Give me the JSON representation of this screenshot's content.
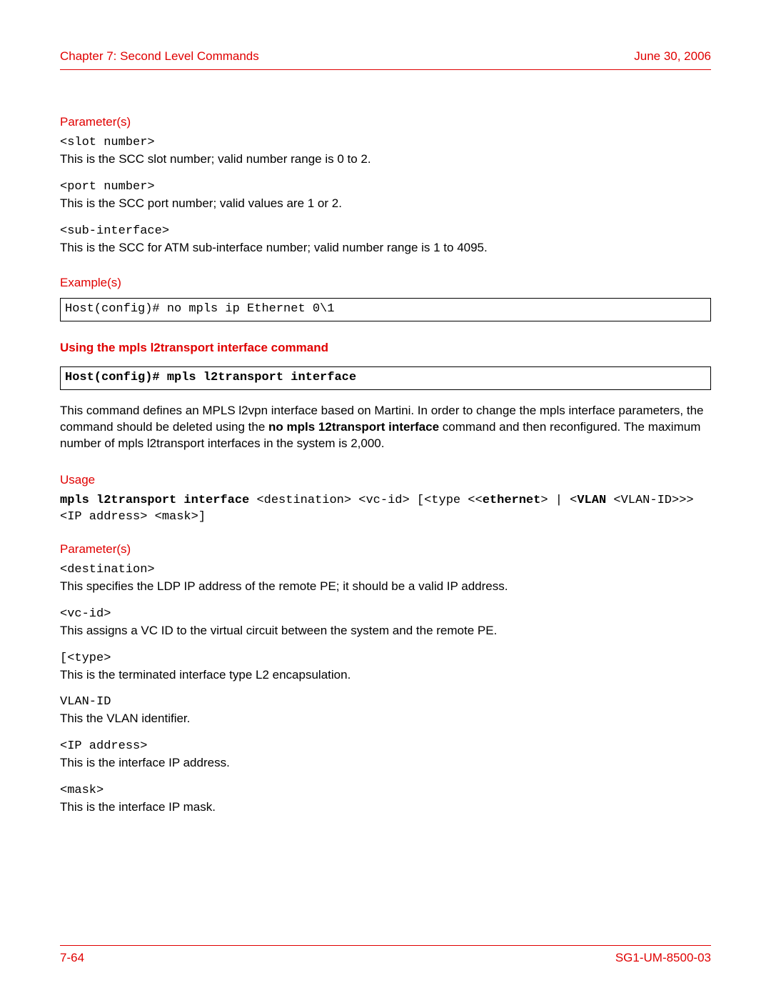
{
  "header": {
    "chapter": "Chapter 7: Second Level Commands",
    "date": "June 30, 2006"
  },
  "footer": {
    "page": "7-64",
    "docid": "SG1-UM-8500-03"
  },
  "params1_heading": "Parameter(s)",
  "params1": [
    {
      "term": "<slot number>",
      "desc": "This is the SCC slot number; valid number range is 0 to 2."
    },
    {
      "term": "<port number>",
      "desc": "This is the SCC port number; valid values are 1 or 2."
    },
    {
      "term": "<sub-interface>",
      "desc": "This is the SCC for ATM sub-interface number; valid number range is 1 to 4095."
    }
  ],
  "examples_heading": "Example(s)",
  "example_code": "Host(config)# no mpls ip Ethernet 0\\1",
  "sub_heading": "Using the mpls l2transport interface command",
  "sub_code": "Host(config)# mpls l2transport interface",
  "body_pre": "This command defines an MPLS l2vpn interface based on Martini. In order to change the mpls interface parameters, the command should be deleted using the ",
  "body_bold": "no mpls 12transport interface",
  "body_post": " command and then reconfigured. The maximum number of mpls l2transport interfaces in the system is 2,000.",
  "usage_heading": "Usage",
  "usage": {
    "b1": "mpls l2transport interface ",
    "p1": "<destination> <vc-id> [<type <<",
    "b2": "ethernet",
    "p2": ">  | <",
    "b3": "VLAN",
    "p3": " <VLAN-ID>>> <IP address> <mask>]"
  },
  "params2_heading": "Parameter(s)",
  "params2": [
    {
      "term": "<destination>",
      "desc": "This specifies the LDP IP address of the remote PE; it should be a valid IP address."
    },
    {
      "term": "<vc-id>",
      "desc": "This assigns a VC ID to the virtual circuit between the system and the remote PE."
    },
    {
      "term": "[<type>",
      "desc": "This is the terminated interface type L2 encapsulation."
    },
    {
      "term": "VLAN-ID",
      "desc": "This the VLAN identifier."
    },
    {
      "term": "<IP address>",
      "desc": "This is the interface IP address."
    },
    {
      "term": "<mask>",
      "desc": "This is the interface IP mask."
    }
  ]
}
